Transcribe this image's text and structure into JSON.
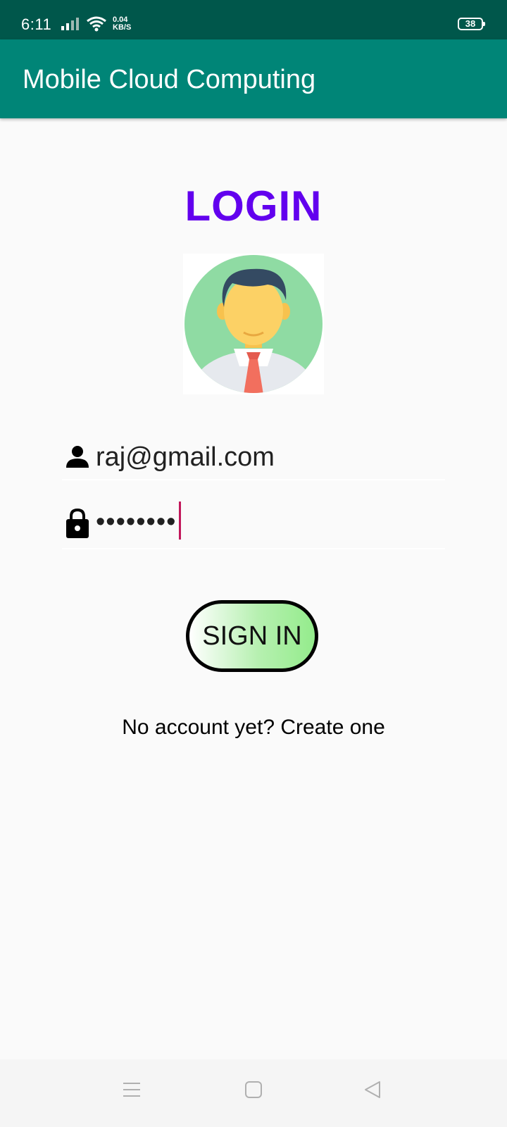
{
  "status_bar": {
    "time": "6:11",
    "network_speed_value": "0.04",
    "network_speed_unit": "KB/S",
    "battery_level": "38",
    "icons": [
      "signal-icon",
      "wifi-icon",
      "battery-icon"
    ]
  },
  "app_bar": {
    "title": "Mobile Cloud Computing",
    "color": "#008577"
  },
  "login": {
    "heading": "LOGIN",
    "heading_color": "#6200ee",
    "avatar_icon": "user-avatar-icon",
    "email": {
      "value": "raj@gmail.com",
      "icon": "person-icon"
    },
    "password": {
      "masked_value": "••••••••",
      "icon": "lock-icon"
    },
    "sign_in_label": "SIGN IN",
    "signup_prompt": "No account yet? Create one"
  },
  "nav_bar": {
    "icons": [
      "menu-icon",
      "home-icon",
      "back-icon"
    ]
  }
}
